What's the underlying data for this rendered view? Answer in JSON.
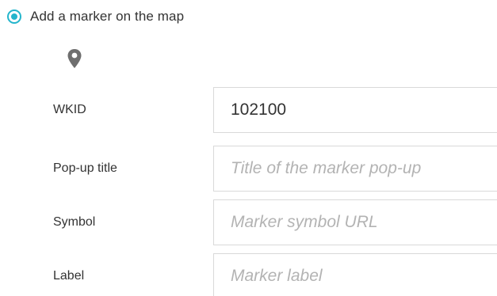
{
  "marker_option": {
    "label": "Add a marker on the map",
    "selected": true
  },
  "colors": {
    "accent": "#24b5cc",
    "text": "#333333",
    "placeholder": "#b3b3b3",
    "border": "#d9d9d9",
    "icon": "#6e6e6e"
  },
  "marker_icon": "map-pin-icon",
  "fields": {
    "wkid": {
      "label": "WKID",
      "value": "102100",
      "placeholder": ""
    },
    "popup_title": {
      "label": "Pop-up title",
      "value": "",
      "placeholder": "Title of the marker pop-up"
    },
    "symbol": {
      "label": "Symbol",
      "value": "",
      "placeholder": "Marker symbol URL"
    },
    "label": {
      "label": "Label",
      "value": "",
      "placeholder": "Marker label"
    }
  }
}
